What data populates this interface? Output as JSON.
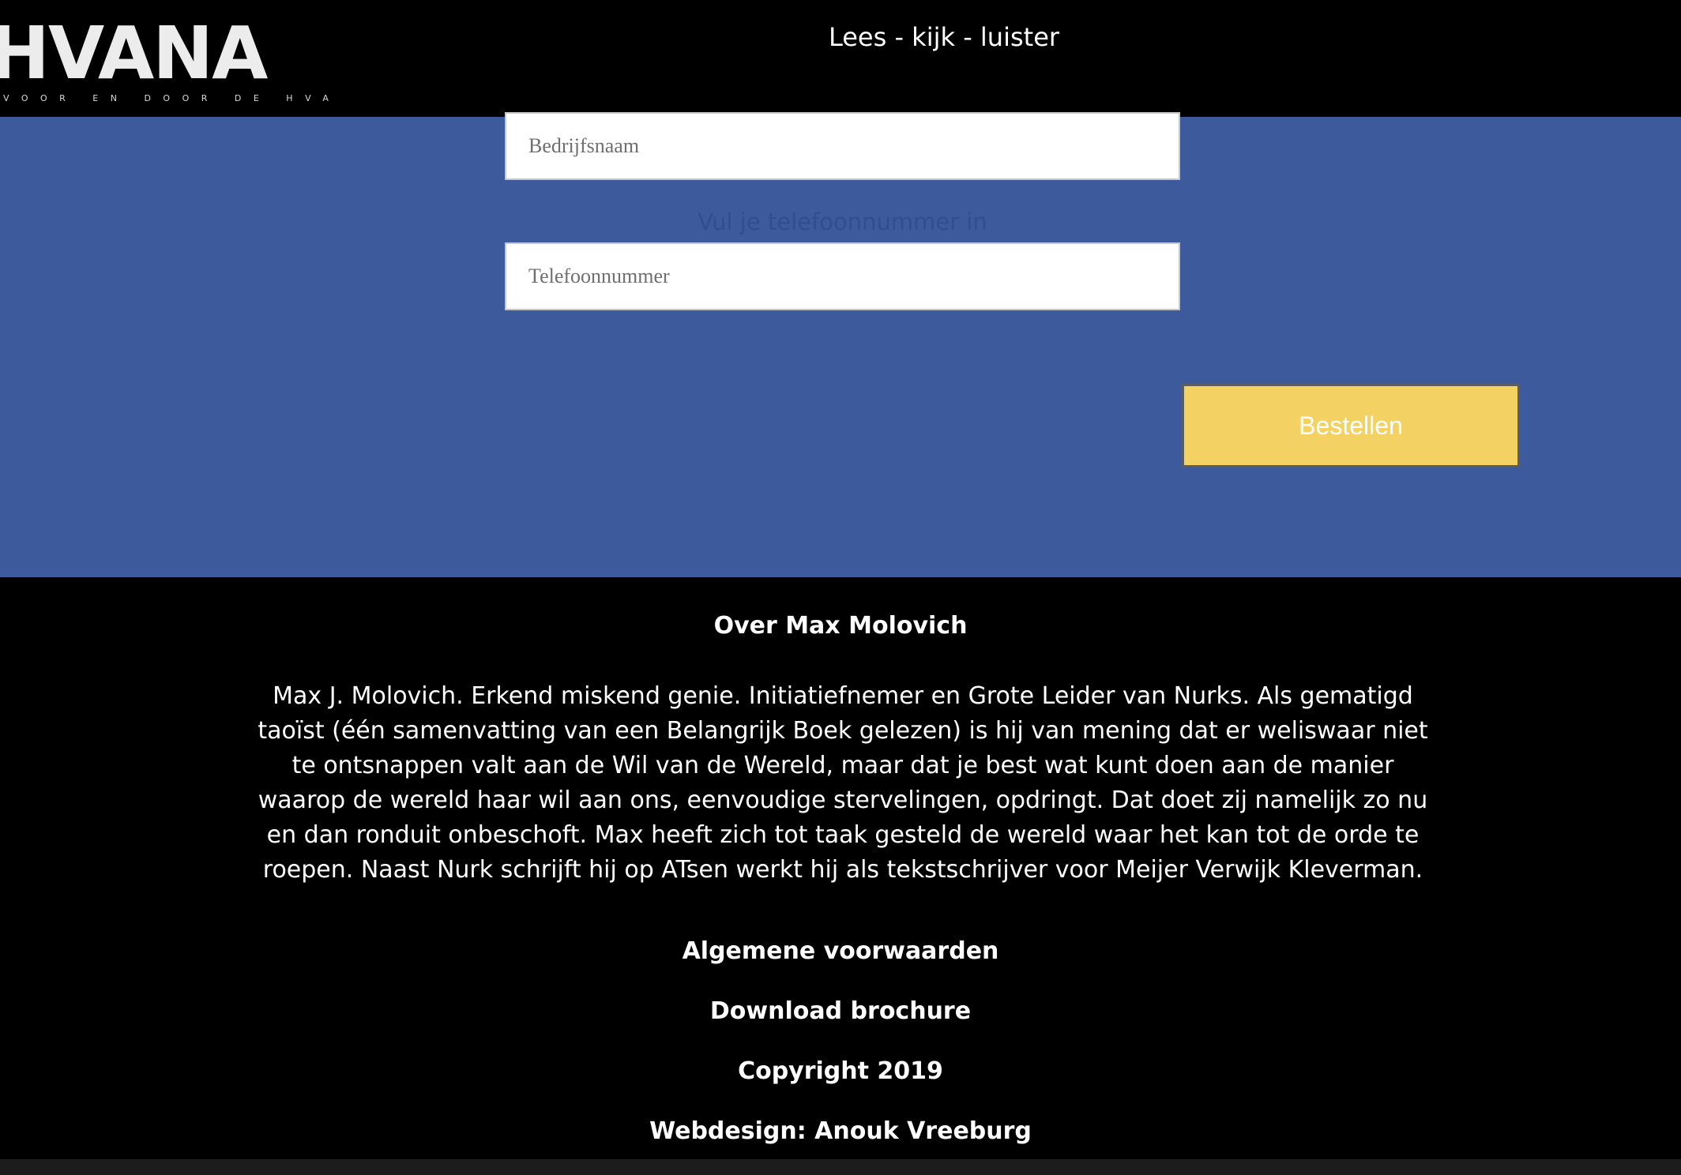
{
  "header": {
    "logo_text": "HVANA",
    "logo_tagline": "VOOR EN DOOR DE HVA",
    "nav_title": "Lees - kijk - luister"
  },
  "form": {
    "company_field": {
      "placeholder": "Bedrijfsnaam",
      "value": ""
    },
    "phone_label": "Vul je telefoonnummer in",
    "phone_field": {
      "placeholder": "Telefoonnummer",
      "value": ""
    },
    "order_button_label": "Bestellen"
  },
  "footer": {
    "heading": "Over Max Molovich",
    "bio": "Max J. Molovich. Erkend miskend genie. Initiatiefnemer en Grote Leider van Nurks. Als gematigd taoïst (één samenvatting van een Belangrijk Boek gelezen) is hij van mening dat er weliswaar niet te ontsnappen valt aan de Wil van de Wereld, maar dat je best wat kunt doen aan de manier waarop de wereld haar wil aan ons, eenvoudige stervelingen, opdringt. Dat doet zij namelijk zo nu en dan ronduit onbeschoft. Max heeft zich tot taak gesteld de wereld waar het kan tot de orde te roepen. Naast Nurk schrijft hij op ATsen werkt hij als tekstschrijver voor Meijer Verwijk Kleverman.",
    "terms_link": "Algemene voorwaarden",
    "brochure_link": "Download brochure",
    "copyright": "Copyright 2019",
    "credit": "Webdesign: Anouk Vreeburg"
  },
  "colors": {
    "form_background": "#3c5a9c",
    "button_background": "#f4d163",
    "page_background": "#000000"
  }
}
